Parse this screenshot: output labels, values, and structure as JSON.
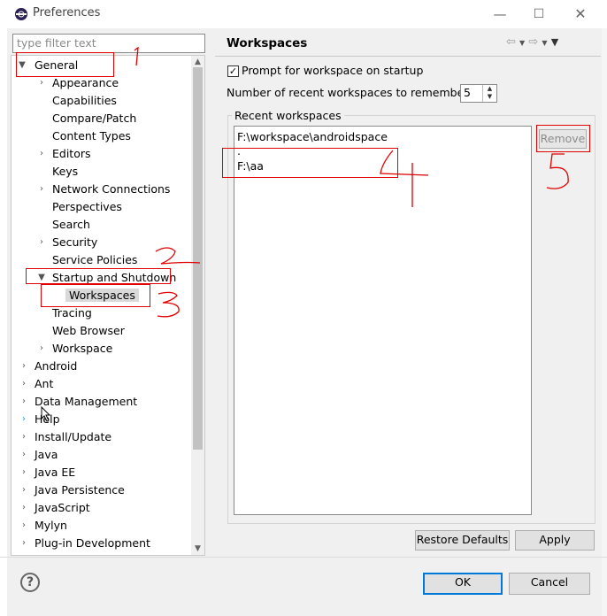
{
  "window": {
    "title": "Preferences"
  },
  "filter": {
    "placeholder": "type filter text"
  },
  "tree": {
    "general": "General",
    "general_children": [
      "Appearance",
      "Capabilities",
      "Compare/Patch",
      "Content Types",
      "Editors",
      "Keys",
      "Network Connections",
      "Perspectives",
      "Search",
      "Security",
      "Service Policies"
    ],
    "startup": "Startup and Shutdown",
    "workspaces_child": "Workspaces",
    "after_startup": [
      "Tracing",
      "Web Browser",
      "Workspace"
    ],
    "top_level": [
      "Android",
      "Ant",
      "Data Management",
      "Help",
      "Install/Update",
      "Java",
      "Java EE",
      "Java Persistence",
      "JavaScript",
      "Mylyn",
      "Plug-in Development"
    ]
  },
  "page": {
    "title": "Workspaces",
    "prompt_checkbox_label": "Prompt for workspace on startup",
    "prompt_checked": true,
    "recent_count_label": "Number of recent workspaces to remember:",
    "recent_count_value": "5",
    "recent_group_label": "Recent workspaces",
    "recent_list": [
      "F:\\workspace\\androidspace",
      ".",
      "F:\\aa"
    ],
    "remove_label": "Remove",
    "restore_defaults_label": "Restore Defaults",
    "apply_label": "Apply"
  },
  "footer": {
    "ok_label": "OK",
    "cancel_label": "Cancel"
  },
  "annotations": {
    "note1": "1",
    "note2": "2",
    "note3": "3",
    "note4": "4",
    "note5": "5"
  },
  "colors": {
    "annotation_red": "#e00000",
    "focus_blue": "#0078d7"
  }
}
